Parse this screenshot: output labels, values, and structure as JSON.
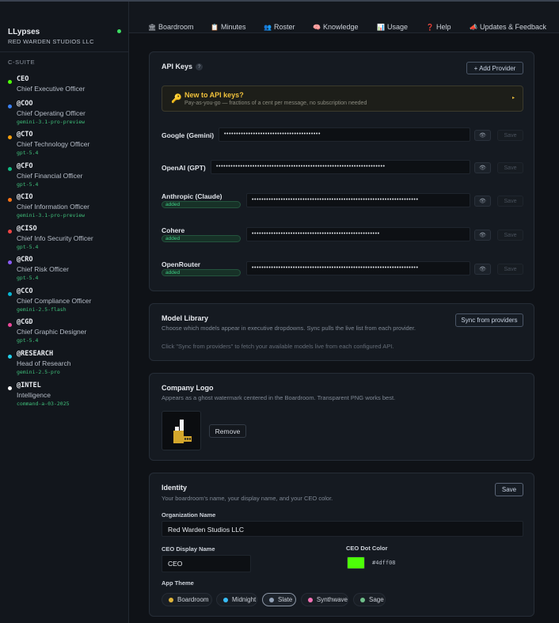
{
  "brand": {
    "title": "LLypses",
    "subtitle": "RED WARDEN STUDIOS LLC"
  },
  "sidebar": {
    "section": "C-SUITE",
    "execs": [
      {
        "handle": "CEO",
        "role": "Chief Executive Officer",
        "model": "",
        "color": "#4dff08"
      },
      {
        "handle": "@COO",
        "role": "Chief Operating Officer",
        "model": "gemini-3.1-pro-preview",
        "color": "#3b82f6"
      },
      {
        "handle": "@CTO",
        "role": "Chief Technology Officer",
        "model": "gpt-5.4",
        "color": "#f59e0b"
      },
      {
        "handle": "@CFO",
        "role": "Chief Financial Officer",
        "model": "gpt-5.4",
        "color": "#10b981"
      },
      {
        "handle": "@CIO",
        "role": "Chief Information Officer",
        "model": "gemini-3.1-pro-preview",
        "color": "#f97316"
      },
      {
        "handle": "@CISO",
        "role": "Chief Info Security Officer",
        "model": "gpt-5.4",
        "color": "#ef4444"
      },
      {
        "handle": "@CRO",
        "role": "Chief Risk Officer",
        "model": "gpt-5.4",
        "color": "#8b5cf6"
      },
      {
        "handle": "@CCO",
        "role": "Chief Compliance Officer",
        "model": "gemini-2.5-flash",
        "color": "#06b6d4"
      },
      {
        "handle": "@CGD",
        "role": "Chief Graphic Designer",
        "model": "gpt-5.4",
        "color": "#ec4899"
      },
      {
        "handle": "@RESEARCH",
        "role": "Head of Research",
        "model": "gemini-2.5-pro",
        "color": "#22d3ee"
      },
      {
        "handle": "@INTEL",
        "role": "Intelligence",
        "model": "command-a-03-2025",
        "color": "#ffffff"
      }
    ]
  },
  "nav": [
    {
      "label": "Boardroom",
      "icon": "🏛"
    },
    {
      "label": "Minutes",
      "icon": "📋"
    },
    {
      "label": "Roster",
      "icon": "👥"
    },
    {
      "label": "Knowledge",
      "icon": "🧠"
    },
    {
      "label": "Usage",
      "icon": "📊"
    },
    {
      "label": "Help",
      "icon": "❓"
    },
    {
      "label": "Updates & Feedback",
      "icon": "📣"
    }
  ],
  "api": {
    "title": "API Keys",
    "help": "?",
    "add_provider": "+ Add Provider",
    "banner_title": "New to API keys?",
    "banner_sub": "Pay-as-you-go — fractions of a cent per message, no subscription needed",
    "banner_arrow": "▸",
    "added_label": "added",
    "save_label": "Save",
    "eye": "👁",
    "providers": [
      {
        "name": "Google (Gemini)",
        "mask": "••••••••••••••••••••••••••••••••••••••••"
      },
      {
        "name": "OpenAI (GPT)",
        "mask": "••••••••••••••••••••••••••••••••••••••••••••••••••••••••••••••••••••••"
      },
      {
        "name": "Anthropic (Claude)",
        "mask": "•••••••••••••••••••••••••••••••••••••••••••••••••••••••••••••••••••••"
      },
      {
        "name": "Cohere",
        "mask": "•••••••••••••••••••••••••••••••••••••••••••••••••••••"
      },
      {
        "name": "OpenRouter",
        "mask": "•••••••••••••••••••••••••••••••••••••••••••••••••••••••••••••••••••••"
      }
    ]
  },
  "models": {
    "title": "Model Library",
    "desc": "Choose which models appear in executive dropdowns. Sync pulls the live list from each provider.",
    "sync": "Sync from providers",
    "hint": "Click \"Sync from providers\" to fetch your available models live from each configured API."
  },
  "logo": {
    "title": "Company Logo",
    "desc": "Appears as a ghost watermark centered in the Boardroom. Transparent PNG works best.",
    "remove": "Remove"
  },
  "identity": {
    "title": "Identity",
    "desc": "Your boardroom's name, your display name, and your CEO color.",
    "save": "Save",
    "org_label": "Organization Name",
    "org_value": "Red Warden Studios LLC",
    "ceo_label": "CEO Display Name",
    "ceo_value": "CEO",
    "dot_label": "CEO Dot Color",
    "dot_hex": "#4dff08",
    "theme_label": "App Theme",
    "themes": [
      {
        "label": "Boardroom",
        "color": "#e0b43a"
      },
      {
        "label": "Midnight",
        "color": "#38bdf8"
      },
      {
        "label": "Slate",
        "color": "#94a3b8"
      },
      {
        "label": "Synthwave",
        "color": "#f472b6"
      },
      {
        "label": "Sage",
        "color": "#6fbf8a"
      }
    ]
  }
}
